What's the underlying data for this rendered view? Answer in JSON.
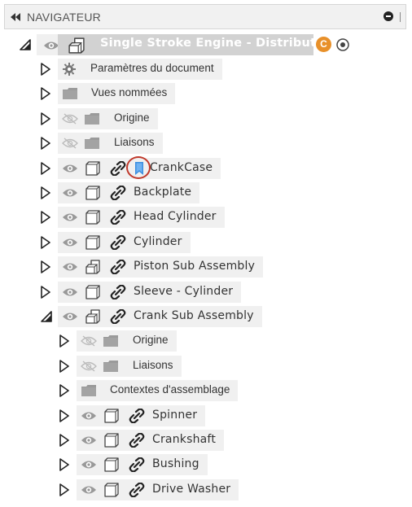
{
  "panel": {
    "title": "NAVIGATEUR"
  },
  "root": {
    "label": "Single Stroke Engine - Distributed",
    "badge": "C",
    "accent_color": "#e8902a"
  },
  "rows": [
    {
      "label": "Paramètres du document",
      "type": "settings",
      "visible": null
    },
    {
      "label": "Vues nommées",
      "type": "folder",
      "visible": null
    },
    {
      "label": "Origine",
      "type": "folder",
      "visible": false
    },
    {
      "label": "Liaisons",
      "type": "folder",
      "visible": false
    },
    {
      "label": "CrankCase",
      "type": "component-linked",
      "visible": true,
      "grounded": true
    },
    {
      "label": "Backplate",
      "type": "component-linked",
      "visible": true
    },
    {
      "label": "Head Cylinder",
      "type": "component-linked",
      "visible": true
    },
    {
      "label": "Cylinder",
      "type": "component-linked",
      "visible": true
    },
    {
      "label": "Piston Sub Assembly",
      "type": "assembly-linked",
      "visible": true
    },
    {
      "label": "Sleeve - Cylinder",
      "type": "component-linked",
      "visible": true
    },
    {
      "label": "Crank Sub Assembly",
      "type": "assembly-linked",
      "visible": true,
      "expanded": true
    },
    {
      "label": "Origine",
      "type": "folder",
      "visible": false
    },
    {
      "label": "Liaisons",
      "type": "folder",
      "visible": false
    },
    {
      "label": "Contextes d'assemblage",
      "type": "folder",
      "visible": null
    },
    {
      "label": "Spinner",
      "type": "component-linked",
      "visible": true
    },
    {
      "label": "Crankshaft",
      "type": "component-linked",
      "visible": true
    },
    {
      "label": "Bushing",
      "type": "component-linked",
      "visible": true
    },
    {
      "label": "Drive Washer",
      "type": "component-linked",
      "visible": true
    }
  ]
}
